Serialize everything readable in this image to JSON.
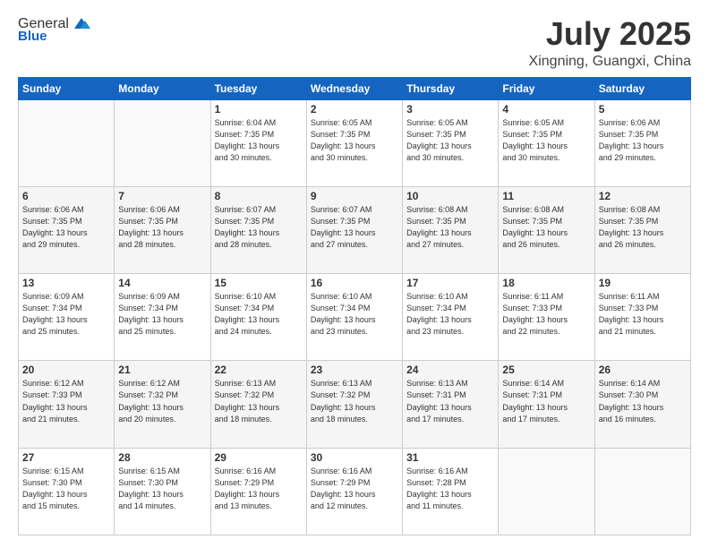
{
  "header": {
    "logo_line1": "General",
    "logo_line2": "Blue",
    "month": "July 2025",
    "location": "Xingning, Guangxi, China"
  },
  "weekdays": [
    "Sunday",
    "Monday",
    "Tuesday",
    "Wednesday",
    "Thursday",
    "Friday",
    "Saturday"
  ],
  "weeks": [
    [
      {
        "day": "",
        "info": ""
      },
      {
        "day": "",
        "info": ""
      },
      {
        "day": "1",
        "info": "Sunrise: 6:04 AM\nSunset: 7:35 PM\nDaylight: 13 hours\nand 30 minutes."
      },
      {
        "day": "2",
        "info": "Sunrise: 6:05 AM\nSunset: 7:35 PM\nDaylight: 13 hours\nand 30 minutes."
      },
      {
        "day": "3",
        "info": "Sunrise: 6:05 AM\nSunset: 7:35 PM\nDaylight: 13 hours\nand 30 minutes."
      },
      {
        "day": "4",
        "info": "Sunrise: 6:05 AM\nSunset: 7:35 PM\nDaylight: 13 hours\nand 30 minutes."
      },
      {
        "day": "5",
        "info": "Sunrise: 6:06 AM\nSunset: 7:35 PM\nDaylight: 13 hours\nand 29 minutes."
      }
    ],
    [
      {
        "day": "6",
        "info": "Sunrise: 6:06 AM\nSunset: 7:35 PM\nDaylight: 13 hours\nand 29 minutes."
      },
      {
        "day": "7",
        "info": "Sunrise: 6:06 AM\nSunset: 7:35 PM\nDaylight: 13 hours\nand 28 minutes."
      },
      {
        "day": "8",
        "info": "Sunrise: 6:07 AM\nSunset: 7:35 PM\nDaylight: 13 hours\nand 28 minutes."
      },
      {
        "day": "9",
        "info": "Sunrise: 6:07 AM\nSunset: 7:35 PM\nDaylight: 13 hours\nand 27 minutes."
      },
      {
        "day": "10",
        "info": "Sunrise: 6:08 AM\nSunset: 7:35 PM\nDaylight: 13 hours\nand 27 minutes."
      },
      {
        "day": "11",
        "info": "Sunrise: 6:08 AM\nSunset: 7:35 PM\nDaylight: 13 hours\nand 26 minutes."
      },
      {
        "day": "12",
        "info": "Sunrise: 6:08 AM\nSunset: 7:35 PM\nDaylight: 13 hours\nand 26 minutes."
      }
    ],
    [
      {
        "day": "13",
        "info": "Sunrise: 6:09 AM\nSunset: 7:34 PM\nDaylight: 13 hours\nand 25 minutes."
      },
      {
        "day": "14",
        "info": "Sunrise: 6:09 AM\nSunset: 7:34 PM\nDaylight: 13 hours\nand 25 minutes."
      },
      {
        "day": "15",
        "info": "Sunrise: 6:10 AM\nSunset: 7:34 PM\nDaylight: 13 hours\nand 24 minutes."
      },
      {
        "day": "16",
        "info": "Sunrise: 6:10 AM\nSunset: 7:34 PM\nDaylight: 13 hours\nand 23 minutes."
      },
      {
        "day": "17",
        "info": "Sunrise: 6:10 AM\nSunset: 7:34 PM\nDaylight: 13 hours\nand 23 minutes."
      },
      {
        "day": "18",
        "info": "Sunrise: 6:11 AM\nSunset: 7:33 PM\nDaylight: 13 hours\nand 22 minutes."
      },
      {
        "day": "19",
        "info": "Sunrise: 6:11 AM\nSunset: 7:33 PM\nDaylight: 13 hours\nand 21 minutes."
      }
    ],
    [
      {
        "day": "20",
        "info": "Sunrise: 6:12 AM\nSunset: 7:33 PM\nDaylight: 13 hours\nand 21 minutes."
      },
      {
        "day": "21",
        "info": "Sunrise: 6:12 AM\nSunset: 7:32 PM\nDaylight: 13 hours\nand 20 minutes."
      },
      {
        "day": "22",
        "info": "Sunrise: 6:13 AM\nSunset: 7:32 PM\nDaylight: 13 hours\nand 18 minutes."
      },
      {
        "day": "23",
        "info": "Sunrise: 6:13 AM\nSunset: 7:32 PM\nDaylight: 13 hours\nand 18 minutes."
      },
      {
        "day": "24",
        "info": "Sunrise: 6:13 AM\nSunset: 7:31 PM\nDaylight: 13 hours\nand 17 minutes."
      },
      {
        "day": "25",
        "info": "Sunrise: 6:14 AM\nSunset: 7:31 PM\nDaylight: 13 hours\nand 17 minutes."
      },
      {
        "day": "26",
        "info": "Sunrise: 6:14 AM\nSunset: 7:30 PM\nDaylight: 13 hours\nand 16 minutes."
      }
    ],
    [
      {
        "day": "27",
        "info": "Sunrise: 6:15 AM\nSunset: 7:30 PM\nDaylight: 13 hours\nand 15 minutes."
      },
      {
        "day": "28",
        "info": "Sunrise: 6:15 AM\nSunset: 7:30 PM\nDaylight: 13 hours\nand 14 minutes."
      },
      {
        "day": "29",
        "info": "Sunrise: 6:16 AM\nSunset: 7:29 PM\nDaylight: 13 hours\nand 13 minutes."
      },
      {
        "day": "30",
        "info": "Sunrise: 6:16 AM\nSunset: 7:29 PM\nDaylight: 13 hours\nand 12 minutes."
      },
      {
        "day": "31",
        "info": "Sunrise: 6:16 AM\nSunset: 7:28 PM\nDaylight: 13 hours\nand 11 minutes."
      },
      {
        "day": "",
        "info": ""
      },
      {
        "day": "",
        "info": ""
      }
    ]
  ]
}
